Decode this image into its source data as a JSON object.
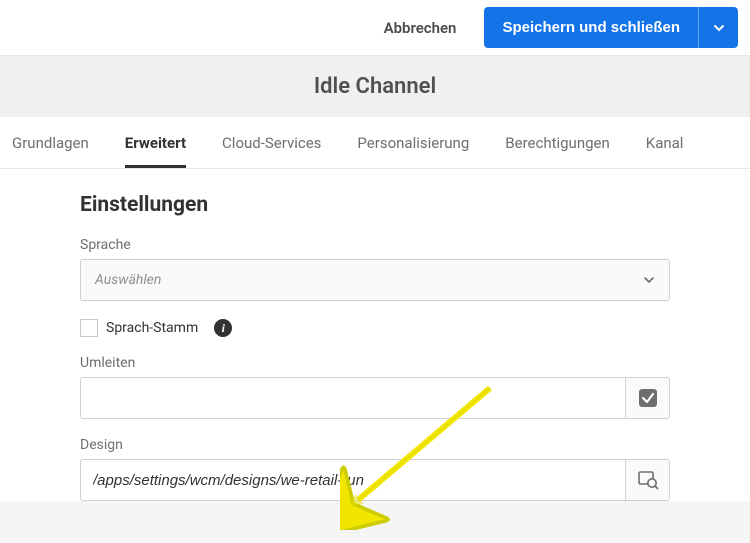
{
  "header": {
    "cancel": "Abbrechen",
    "save": "Speichern und schließen"
  },
  "title": "Idle Channel",
  "tabs": [
    {
      "label": "Grundlagen"
    },
    {
      "label": "Erweitert"
    },
    {
      "label": "Cloud-Services"
    },
    {
      "label": "Personalisierung"
    },
    {
      "label": "Berechtigungen"
    },
    {
      "label": "Kanal"
    }
  ],
  "settings": {
    "heading": "Einstellungen",
    "sprache_label": "Sprache",
    "sprache_placeholder": "Auswählen",
    "sprach_stamm_label": "Sprach-Stamm",
    "umleiten_label": "Umleiten",
    "umleiten_value": "",
    "design_label": "Design",
    "design_value": "/apps/settings/wcm/designs/we-retail-run"
  }
}
